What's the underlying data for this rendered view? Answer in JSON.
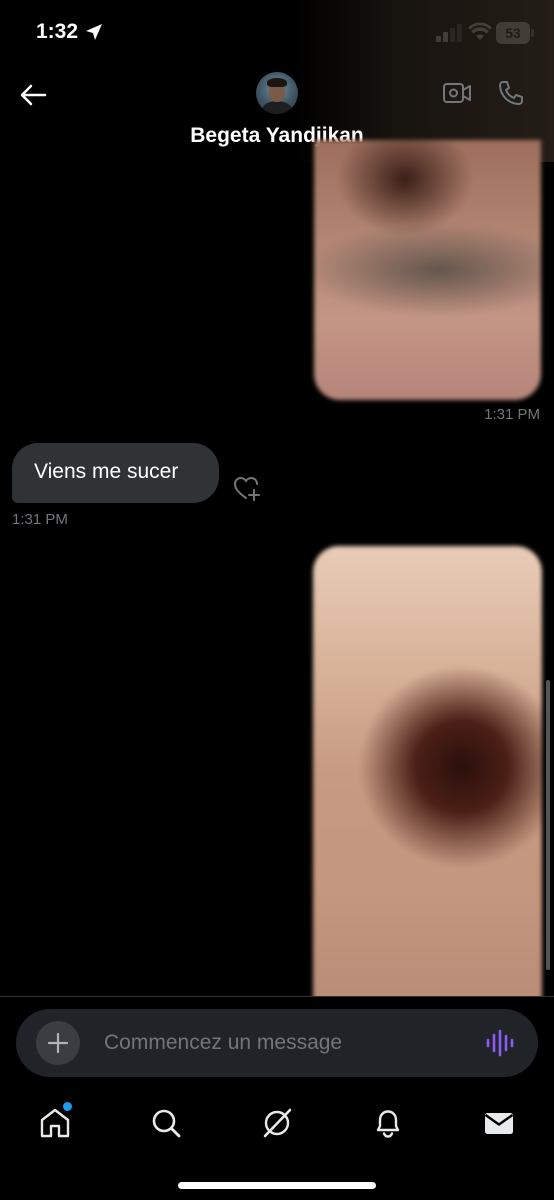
{
  "status_bar": {
    "time": "1:32",
    "battery": "53",
    "icons": [
      "location-arrow-icon",
      "cellular-signal-icon",
      "wifi-icon",
      "battery-icon"
    ]
  },
  "header": {
    "contact_name": "Begeta Yandjikan",
    "icons": [
      "back-arrow-icon",
      "video-camera-icon",
      "phone-icon"
    ]
  },
  "messages": [
    {
      "direction": "sent",
      "kind": "image",
      "timestamp": "1:31 PM"
    },
    {
      "direction": "received",
      "kind": "text",
      "text": "Viens me sucer",
      "timestamp": "1:31 PM"
    },
    {
      "direction": "sent",
      "kind": "image"
    }
  ],
  "composer": {
    "placeholder": "Commencez un message",
    "value": "",
    "icons": [
      "plus-icon",
      "voice-wave-icon"
    ]
  },
  "tabbar": {
    "tabs": [
      "home",
      "search",
      "grok",
      "notifications",
      "messages"
    ],
    "active": "messages",
    "home_has_dot": true
  },
  "colors": {
    "background": "#000000",
    "bubble_received": "#2f3336",
    "timestamp": "#71767b",
    "accent_blue": "#1d9bf0",
    "voice_accent": "#8b5cf6"
  }
}
